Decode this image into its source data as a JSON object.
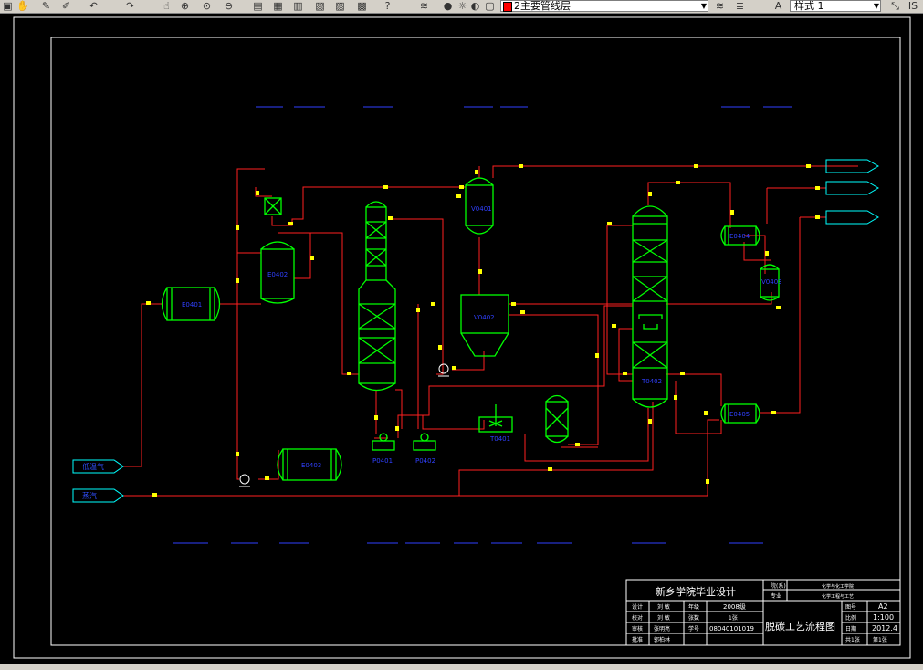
{
  "toolbar": {
    "layer_name": "2主要管线层",
    "style_name": "样式 1",
    "right_label": "IS",
    "layer_color": "#ff0000"
  },
  "drawing": {
    "inputs": [
      "低温气",
      "蒸汽"
    ],
    "title_block": {
      "school": "新乡学院毕业设计",
      "drawing_title": "脱碳工艺流程图",
      "cells": {
        "r1c1": "设计",
        "r1c2": "刘 敏",
        "r1c3": "年级",
        "r1c4": "2008级",
        "r2c1": "校对",
        "r2c2": "刘 敏",
        "r2c3": "张数",
        "r2c4": "1张",
        "r3c1": "审核",
        "r3c2": "张明亮",
        "r3c3": "学号",
        "r3c4": "08040101019",
        "r4c1": "批准",
        "r4c2": "郭柏林"
      },
      "top_right": {
        "k1": "院(系)",
        "v1": "化学与化工学院",
        "k2": "专业",
        "v2": "化学工程与工艺"
      },
      "right": [
        {
          "k": "图号",
          "v": "A2"
        },
        {
          "k": "比例",
          "v": "1:100"
        },
        {
          "k": "日期",
          "v": "2012.4"
        },
        {
          "k": "共1张",
          "v": "第1张"
        }
      ]
    },
    "equipment": {
      "e1": "E0401",
      "e2": "E0402",
      "e3": "E0403",
      "e4": "E0404",
      "e5": "E0405",
      "t1": "T0401",
      "t2": "T0402",
      "v1": "V0401",
      "v2": "V0402",
      "v3": "V0403",
      "p1": "P0401",
      "p2": "P0402"
    }
  },
  "colors": {
    "pipe": "#ff2020",
    "equipment": "#00ff00",
    "label": "#3040ff",
    "frame": "#ffffff",
    "arrow": "#ffff00"
  }
}
